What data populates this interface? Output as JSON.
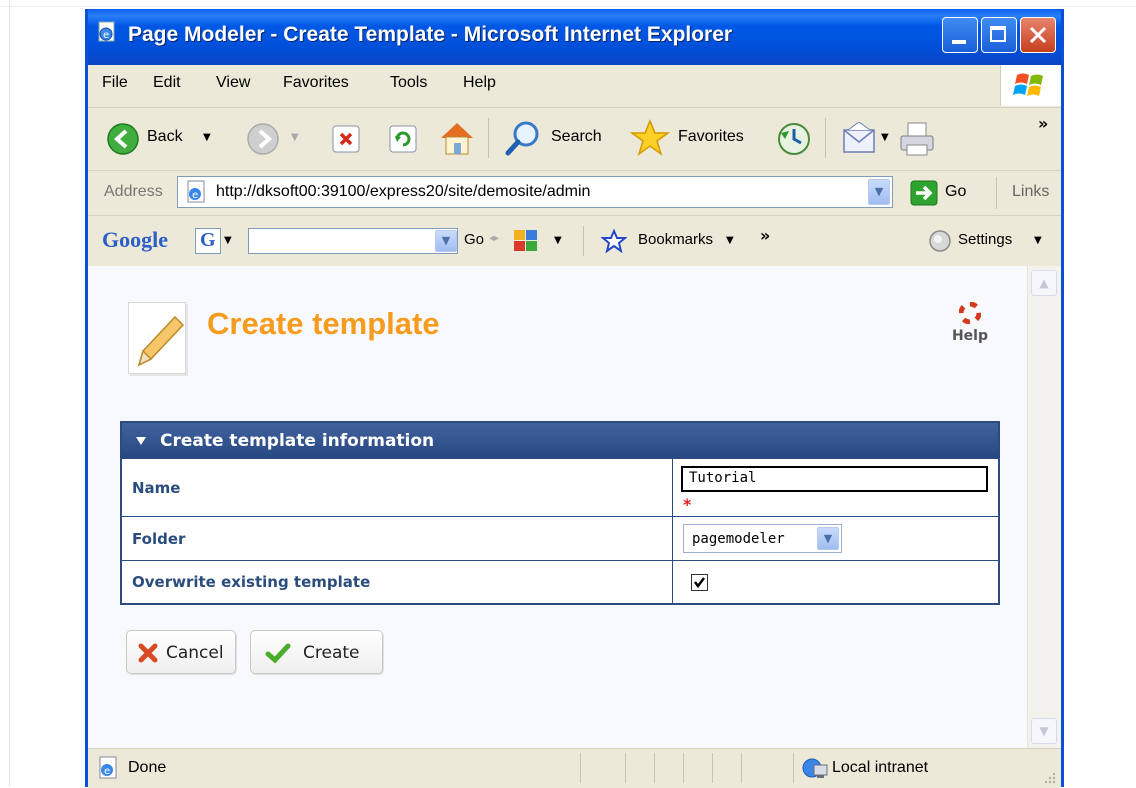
{
  "window": {
    "title": "Page Modeler - Create Template - Microsoft Internet Explorer"
  },
  "menu": [
    "File",
    "Edit",
    "View",
    "Favorites",
    "Tools",
    "Help"
  ],
  "toolbar": {
    "back": "Back",
    "search": "Search",
    "favorites": "Favorites",
    "more": "»"
  },
  "address": {
    "label": "Address",
    "url": "http://dksoft00:39100/express20/site/demosite/admin",
    "go": "Go",
    "links": "Links"
  },
  "google": {
    "logo": "Google",
    "go": "Go",
    "bookmarks": "Bookmarks",
    "more": "»",
    "settings": "Settings"
  },
  "page": {
    "title": "Create template",
    "help": "Help"
  },
  "form": {
    "section_title": "Create template information",
    "name_label": "Name",
    "name_value": "Tutorial",
    "required_mark": "*",
    "folder_label": "Folder",
    "folder_value": "pagemodeler",
    "overwrite_label": "Overwrite existing template",
    "overwrite_checked": true
  },
  "buttons": {
    "cancel": "Cancel",
    "create": "Create"
  },
  "status": {
    "text": "Done",
    "zone": "Local intranet"
  },
  "colors": {
    "title_accent": "#f79b1e",
    "section_header": "#2c4b80",
    "label_text": "#2a4d7d",
    "xp_blue": "#0058e6"
  }
}
